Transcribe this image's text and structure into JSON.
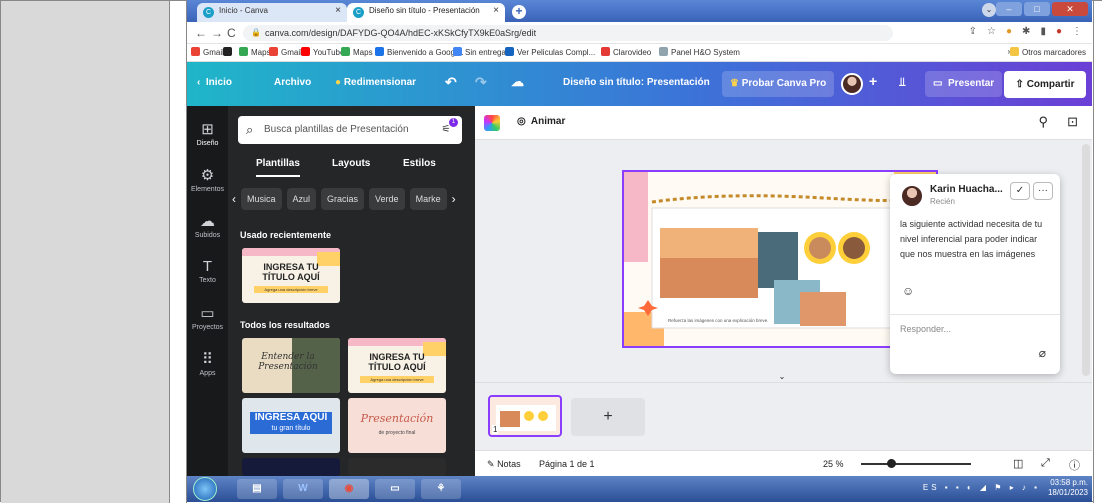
{
  "browser": {
    "tabs": [
      {
        "label": "Inicio - Canva"
      },
      {
        "label": "Diseño sin título - Presentación"
      }
    ],
    "url": "canva.com/design/DAFYDG-QO4A/hdEC-xKSkCfyTX9kE0aSrg/edit",
    "bookmarks": [
      {
        "label": "Gmail",
        "color": "#ea4335"
      },
      {
        "label": "",
        "color": "#222222"
      },
      {
        "label": "Maps",
        "color": "#34a853"
      },
      {
        "label": "Gmail",
        "color": "#ea4335"
      },
      {
        "label": "YouTube",
        "color": "#ff0000"
      },
      {
        "label": "Maps",
        "color": "#34a853"
      },
      {
        "label": "Bienvenido a Googl...",
        "color": "#1a73e8"
      },
      {
        "label": "Sin entregar",
        "color": "#4285f4"
      },
      {
        "label": "Ver Peliculas Compl...",
        "color": "#1565c0"
      },
      {
        "label": "Clarovideo",
        "color": "#e53935"
      },
      {
        "label": "Panel H&O System",
        "color": "#90a4ae"
      }
    ],
    "other_bookmarks": "Otros marcadores",
    "more": "»"
  },
  "canva_header": {
    "home": "Inicio",
    "file": "Archivo",
    "resize": "Redimensionar",
    "doc_title": "Diseño sin título: Presentación",
    "try_pro": "Probar Canva Pro",
    "present": "Presentar",
    "share": "Compartir",
    "plus": "+"
  },
  "left_nav": [
    {
      "label": "Diseño",
      "icon": "layout-icon",
      "glyph": "⊞"
    },
    {
      "label": "Elementos",
      "icon": "shapes-icon",
      "glyph": "⚙"
    },
    {
      "label": "Subidos",
      "icon": "upload-cloud-icon",
      "glyph": "☁"
    },
    {
      "label": "Texto",
      "icon": "text-icon",
      "glyph": "T"
    },
    {
      "label": "Proyectos",
      "icon": "folder-icon",
      "glyph": "▭"
    },
    {
      "label": "Apps",
      "icon": "apps-grid-icon",
      "glyph": "⠿"
    }
  ],
  "panel": {
    "search_placeholder": "Busca plantillas de Presentación",
    "filter_badge": "1",
    "tabs": [
      "Plantillas",
      "Layouts",
      "Estilos"
    ],
    "chips": [
      "Musica",
      "Azul",
      "Gracias",
      "Verde",
      "Marke"
    ],
    "recent_title": "Usado recientemente",
    "all_title": "Todos los resultados",
    "templates": [
      {
        "title": "INGRESA TU TÍTULO AQUÍ",
        "subtitle": "Agrega una descripción breve"
      },
      {
        "title": "Entender la Presentación",
        "subtitle": ""
      },
      {
        "title": "INGRESA TU TÍTULO AQUÍ",
        "subtitle": "Agrega una descripción breve"
      },
      {
        "title": "INGRESA AQUÍ",
        "subtitle": "tu gran título"
      },
      {
        "title": "Presentación",
        "subtitle": "de proyecto final"
      }
    ]
  },
  "editor": {
    "animate": "Animar",
    "slide_caption": "Refuerza las imágenes con una explicación breve."
  },
  "comment": {
    "author": "Karin Huacha...",
    "time": "Recién",
    "text": "la siguiente actividad necesita de tu nivel inferencial para poder indicar que nos muestra en las imágenes",
    "reply_placeholder": "Responder..."
  },
  "footer": {
    "notes": "Notas",
    "page": "Página 1 de 1",
    "zoom": "25 %",
    "page_number": "1",
    "zoom_level": 0.25
  },
  "taskbar": {
    "lang": "ES",
    "time": "03:58 p.m.",
    "date": "18/01/2023"
  }
}
